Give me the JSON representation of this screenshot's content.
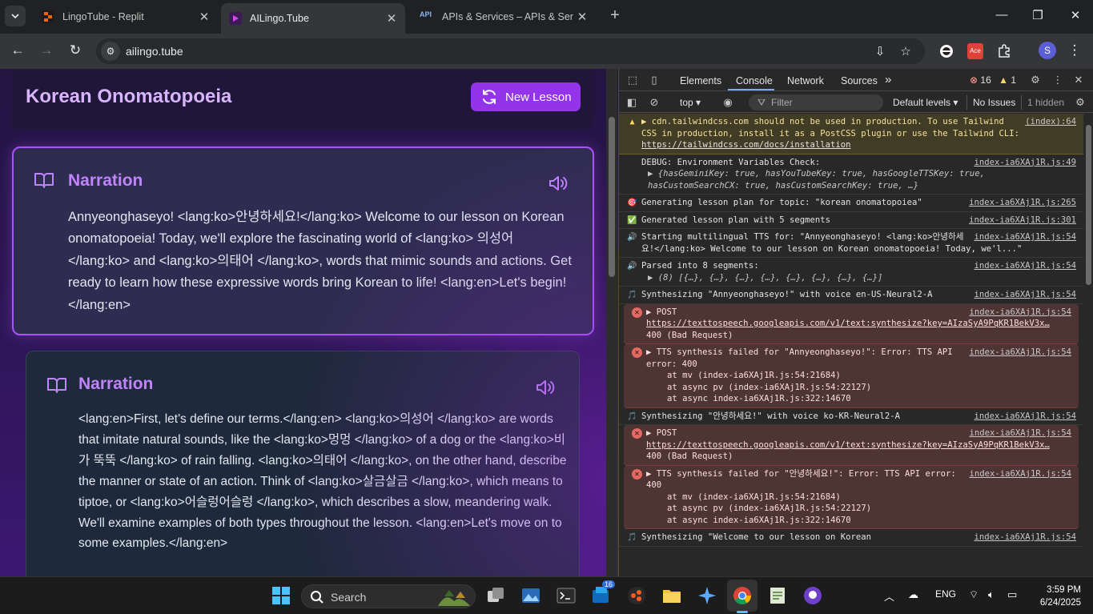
{
  "browser": {
    "tabs": [
      {
        "title": "LingoTube - Replit",
        "active": false
      },
      {
        "title": "AILingo.Tube",
        "active": true
      },
      {
        "title": "APIs & Services – APIs & Services",
        "active": false
      }
    ],
    "url": "ailingo.tube",
    "profile_initial": "S",
    "ext_badge": "Ace",
    "tab_icon_api": "API",
    "new_tab": "+"
  },
  "lesson": {
    "title": "Korean Onomatopoeia",
    "new_lesson_label": "New Lesson",
    "segments": [
      {
        "type": "Narration",
        "text": "Annyeonghaseyo! <lang:ko>안녕하세요!</lang:ko> Welcome to our lesson on Korean onomatopoeia! Today, we'll explore the fascinating world of <lang:ko> 의성어 </lang:ko> and <lang:ko>의태어 </lang:ko>, words that mimic sounds and actions. Get ready to learn how these expressive words bring Korean to life! <lang:en>Let's begin!</lang:en>"
      },
      {
        "type": "Narration",
        "text": "<lang:en>First, let's define our terms.</lang:en> <lang:ko>의성어 </lang:ko> are words that imitate natural sounds, like the <lang:ko>멍멍 </lang:ko> of a dog or the <lang:ko>비가 뚝뚝 </lang:ko> of rain falling. <lang:ko>의태어 </lang:ko>, on the other hand, describe the manner or state of an action. Think of <lang:ko>살금살금 </lang:ko>, which means to tiptoe, or <lang:ko>어슬렁어슬렁 </lang:ko>, which describes a slow, meandering walk. We'll examine examples of both types throughout the lesson. <lang:en>Let's move on to some examples.</lang:en>"
      }
    ]
  },
  "devtools": {
    "tabs": [
      "Elements",
      "Console",
      "Network",
      "Sources"
    ],
    "active_tab": "Console",
    "more_tabs": "»",
    "error_count": "16",
    "warning_count": "1",
    "context": "top",
    "filter_placeholder": "Filter",
    "levels": "Default levels",
    "issues": "No Issues",
    "hidden": "1 hidden",
    "messages": [
      {
        "kind": "warn",
        "icon": "warning-icon",
        "text": "▶ cdn.tailwindcss.com should not be used in production. To use Tailwind CSS in production, install it as a PostCSS plugin or use the Tailwind CLI: ",
        "link": "https://tailwindcss.com/docs/installation",
        "source": "(index):64"
      },
      {
        "kind": "log",
        "icon": "",
        "text": "DEBUG: Environment Variables Check:",
        "sub": "▶ {hasGeminiKey: true, hasYouTubeKey: true, hasGoogleTTSKey: true, hasCustomSearchCX: true, hasCustomSearchKey: true, …}",
        "source": "index-ia6XAj1R.js:49"
      },
      {
        "kind": "log",
        "icon": "🎯",
        "text": "Generating lesson plan for topic: \"korean onomatopoiea\"",
        "source": "index-ia6XAj1R.js:265"
      },
      {
        "kind": "log",
        "icon": "✅",
        "text": "Generated lesson plan with 5 segments",
        "source": "index-ia6XAj1R.js:301"
      },
      {
        "kind": "log",
        "icon": "🔊",
        "text": "Starting multilingual TTS for: \"Annyeonghaseyo! <lang:ko>안녕하세요!</lang:ko> Welcome to our lesson on Korean onomatopoeia! Today, we'l...\"",
        "source": "index-ia6XAj1R.js:54"
      },
      {
        "kind": "log",
        "icon": "🔊",
        "text": "Parsed into 8 segments:",
        "sub": "▶ (8) [{…}, {…}, {…}, {…}, {…}, {…}, {…}, {…}]",
        "source": "index-ia6XAj1R.js:54"
      },
      {
        "kind": "log",
        "icon": "🎵",
        "text": "Synthesizing \"Annyeonghaseyo!\" with voice en-US-Neural2-A",
        "source": "index-ia6XAj1R.js:54"
      },
      {
        "kind": "err",
        "icon": "✕",
        "text": "▶ POST",
        "link": "https://texttospeech.googleapis.com/v1/text:synthesize?key=AIzaSyA9PqKR1BekV3x…",
        "tail": "400 (Bad Request)",
        "source": "index-ia6XAj1R.js:54"
      },
      {
        "kind": "err",
        "icon": "✕",
        "text": "▶ TTS synthesis failed for \"Annyeonghaseyo!\": Error: TTS API error: 400",
        "stack": [
          "at mv (index-ia6XAj1R.js:54:21684)",
          "at async pv (index-ia6XAj1R.js:54:22127)",
          "at async index-ia6XAj1R.js:322:14670"
        ],
        "source": "index-ia6XAj1R.js:54"
      },
      {
        "kind": "log",
        "icon": "🎵",
        "text": "Synthesizing \"안녕하세요!\" with voice ko-KR-Neural2-A",
        "source": "index-ia6XAj1R.js:54"
      },
      {
        "kind": "err",
        "icon": "✕",
        "text": "▶ POST",
        "link": "https://texttospeech.googleapis.com/v1/text:synthesize?key=AIzaSyA9PqKR1BekV3x…",
        "tail": "400 (Bad Request)",
        "source": "index-ia6XAj1R.js:54"
      },
      {
        "kind": "err",
        "icon": "✕",
        "text": "▶ TTS synthesis failed for \"안녕하세요!\": Error: TTS API error: 400",
        "stack": [
          "at mv (index-ia6XAj1R.js:54:21684)",
          "at async pv (index-ia6XAj1R.js:54:22127)",
          "at async index-ia6XAj1R.js:322:14670"
        ],
        "source": "index-ia6XAj1R.js:54"
      },
      {
        "kind": "log",
        "icon": "🎵",
        "text": "Synthesizing \"Welcome to our lesson on Korean",
        "source": "index-ia6XAj1R.js:54"
      }
    ]
  },
  "taskbar": {
    "search_placeholder": "Search",
    "mail_badge": "16",
    "language": "ENG",
    "time": "3:59 PM",
    "date": "6/24/2025"
  }
}
